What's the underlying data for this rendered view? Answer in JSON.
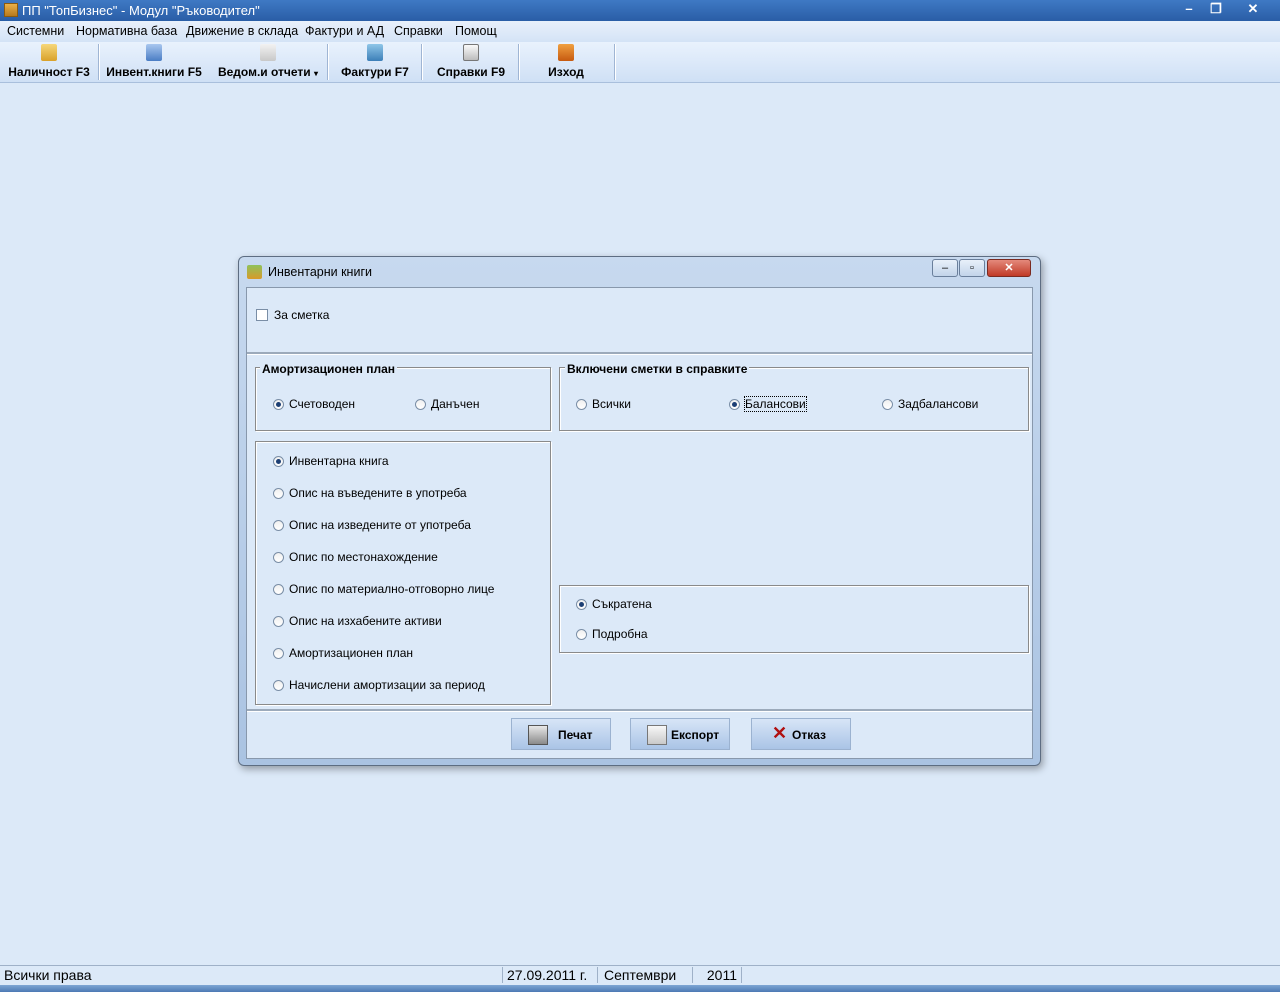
{
  "window": {
    "title": "ПП \"ТопБизнес\" - Модул \"Ръководител\""
  },
  "menu": [
    "Системни",
    "Нормативна база",
    "Движение в склада",
    "Фактури и АД",
    "Справки",
    "Помощ"
  ],
  "toolbar": {
    "availability": "Наличност F3",
    "inventory_books": "Инвент.книги F5",
    "reports": "Ведом.и отчети",
    "invoices": "Фактури F7",
    "inquiries": "Справки  F9",
    "exit": "Изход"
  },
  "dialog": {
    "title": "Инвентарни книги",
    "for_account_label": "За сметка",
    "for_account_checked": false,
    "amortization_plan": {
      "title": "Амортизационен план",
      "options": [
        "Счетоводен",
        "Данъчен"
      ],
      "selected": "Счетоводен"
    },
    "included_accounts": {
      "title": "Включени  сметки в справките",
      "options": [
        "Всички",
        "Балансови",
        "Задбалансови"
      ],
      "selected": "Балансови"
    },
    "report_types": {
      "options": [
        "Инвентарна книга",
        "Опис на въведените в употреба",
        "Опис на изведените от употреба",
        "Опис по местонахождение",
        "Опис по материално-отговорно лице",
        "Опис на изхабените активи",
        "Амортизационен план",
        "Начислени амортизации за период"
      ],
      "selected": "Инвентарна книга"
    },
    "detail": {
      "options": [
        "Съкратена",
        "Подробна"
      ],
      "selected": "Съкратена"
    },
    "buttons": {
      "print": "Печат",
      "export": "Експорт",
      "cancel": "Отказ"
    }
  },
  "status": {
    "rights": "Всички права",
    "date": "27.09.2011 г.",
    "month": "Септември",
    "year": "2011"
  }
}
